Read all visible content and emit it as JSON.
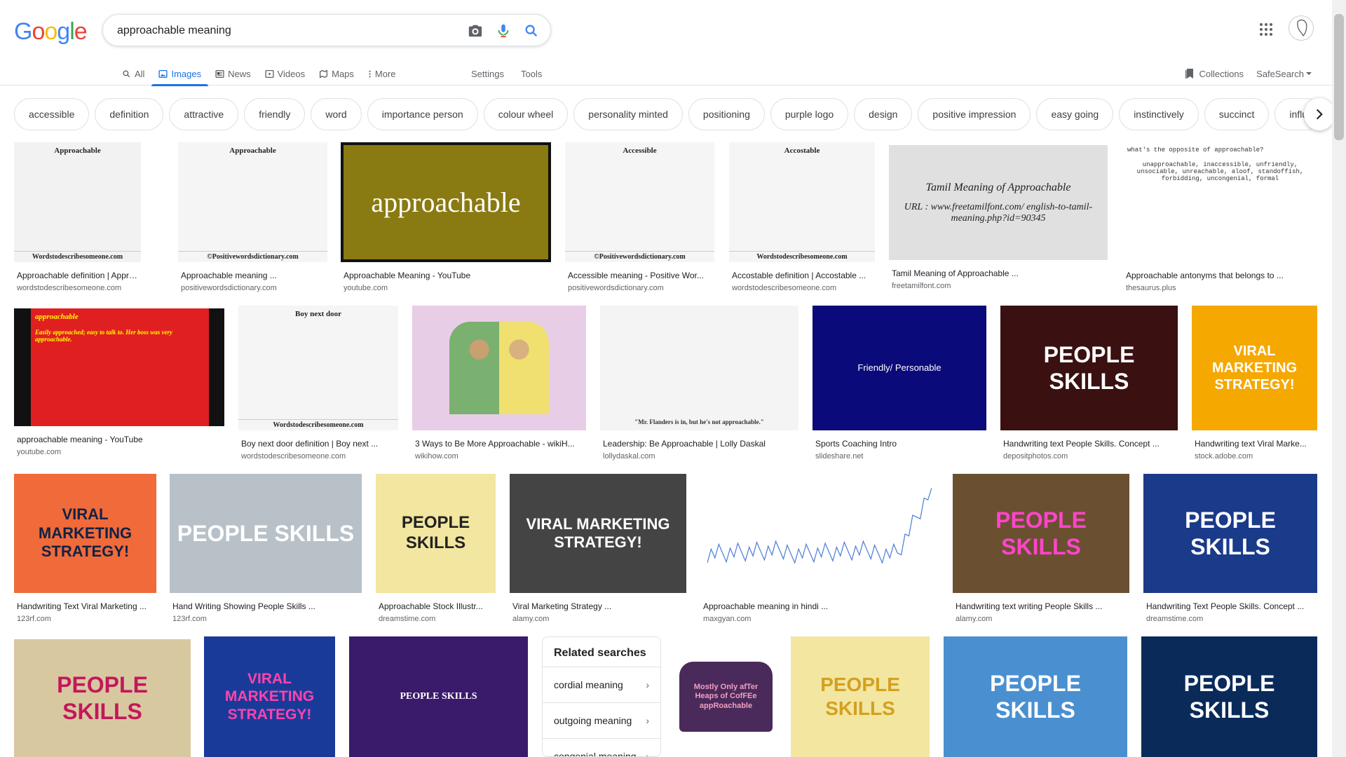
{
  "search": {
    "query": "approachable meaning"
  },
  "logo": [
    "G",
    "o",
    "o",
    "g",
    "l",
    "e"
  ],
  "colors": {
    "accent": "#1a73e8",
    "logo": [
      "#4285f4",
      "#ea4335",
      "#fbbc05",
      "#4285f4",
      "#34a853",
      "#ea4335"
    ]
  },
  "tabs": [
    {
      "label": "All",
      "icon": "search-icon"
    },
    {
      "label": "Images",
      "icon": "image-icon"
    },
    {
      "label": "News",
      "icon": "news-icon"
    },
    {
      "label": "Videos",
      "icon": "video-icon"
    },
    {
      "label": "Maps",
      "icon": "map-icon"
    },
    {
      "label": "More",
      "icon": "more-icon"
    }
  ],
  "tools": {
    "settings": "Settings",
    "tools": "Tools"
  },
  "right_tools": {
    "collections": "Collections",
    "safesearch": "SafeSearch"
  },
  "chips": [
    "accessible",
    "definition",
    "attractive",
    "friendly",
    "word",
    "importance person",
    "colour wheel",
    "personality minted",
    "positioning",
    "purple logo",
    "design",
    "positive impression",
    "easy going",
    "instinctively",
    "succinct",
    "influ"
  ],
  "results": [
    {
      "title": "Approachable definition | Approach...",
      "source": "wordstodescribesomeone.com",
      "img_text": "Approachable",
      "img_footer": "Wordstodescribesomeone.com"
    },
    {
      "title": "Approachable meaning ...",
      "source": "positivewordsdictionary.com",
      "img_text": "Approachable",
      "img_footer": "©Positivewordsdictionary.com"
    },
    {
      "title": "Approachable Meaning - YouTube",
      "source": "youtube.com",
      "img_text": "approachable"
    },
    {
      "title": "Accessible meaning - Positive Wor...",
      "source": "positivewordsdictionary.com",
      "img_text": "Accessible",
      "img_footer": "©Positivewordsdictionary.com"
    },
    {
      "title": "Accostable definition | Accostable ...",
      "source": "wordstodescribesomeone.com",
      "img_text": "Accostable",
      "img_footer": "Wordstodescribesomeone.com"
    },
    {
      "title": "Tamil Meaning of Approachable ...",
      "source": "freetamilfont.com",
      "img_text": "Tamil Meaning of Approachable",
      "img_sub": "URL : www.freetamilfont.com/ english-to-tamil-meaning.php?id=90345"
    },
    {
      "title": "Approachable antonyms that belongs to ...",
      "source": "thesaurus.plus",
      "img_text": "what's the opposite of approachable?",
      "img_sub": "unapproachable, inaccessible, unfriendly, unsociable, unreachable, aloof, standoffish, forbidding, uncongenial, formal"
    },
    {
      "title": "approachable meaning - YouTube",
      "source": "youtube.com",
      "img_text": "approachable",
      "img_sub": "Easily approached; easy to talk to. Her boss was very approachable."
    },
    {
      "title": "Boy next door definition | Boy next ...",
      "source": "wordstodescribesomeone.com",
      "img_text": "Boy next door",
      "img_footer": "Wordstodescribesomeone.com"
    },
    {
      "title": "3 Ways to Be More Approachable - wikiH...",
      "source": "wikihow.com"
    },
    {
      "title": "Leadership: Be Approachable | Lolly Daskal",
      "source": "lollydaskal.com",
      "img_text": "\"Mr. Flanders is in, but he's not approachable.\""
    },
    {
      "title": "Sports Coaching Intro",
      "source": "slideshare.net",
      "img_text": "Friendly/ Personable"
    },
    {
      "title": "Handwriting text People Skills. Concept ...",
      "source": "depositphotos.com",
      "img_text": "PEOPLE SKILLS"
    },
    {
      "title": "Handwriting text Viral Marke...",
      "source": "stock.adobe.com",
      "img_text": "VIRAL MARKETING STRATEGY!"
    },
    {
      "title": "Handwriting Text Viral Marketing ...",
      "source": "123rf.com",
      "img_text": "VIRAL MARKETING STRATEGY!"
    },
    {
      "title": "Hand Writing Showing People Skills ...",
      "source": "123rf.com",
      "img_text": "PEOPLE SKILLS"
    },
    {
      "title": "Approachable Stock Illustr...",
      "source": "dreamstime.com",
      "img_text": "PEOPLE SKILLS"
    },
    {
      "title": "Viral Marketing Strategy ...",
      "source": "alamy.com",
      "img_text": "VIRAL MARKETING STRATEGY!"
    },
    {
      "title": "Approachable meaning in hindi ...",
      "source": "maxgyan.com"
    },
    {
      "title": "Handwriting text writing People Skills ...",
      "source": "alamy.com",
      "img_text": "PEOPLE SKILLS"
    },
    {
      "title": "Handwriting Text People Skills. Concept ...",
      "source": "dreamstime.com",
      "img_text": "PEOPLE SKILLS"
    },
    {
      "img_text": "PEOPLE SKILLS"
    },
    {
      "img_text": "VIRAL MARKETING STRATEGY!"
    },
    {
      "img_text": "PEOPLE SKILLS"
    },
    {
      "img_text": "Mostly Only afTer Heaps of CofFEe appRoachable"
    },
    {
      "img_text": "PEOPLE SKILLS"
    },
    {
      "img_text": "PEOPLE SKILLS"
    },
    {
      "img_text": "PEOPLE SKILLS"
    }
  ],
  "related": {
    "title": "Related searches",
    "items": [
      "cordial meaning",
      "outgoing meaning",
      "congenial meaning"
    ]
  }
}
